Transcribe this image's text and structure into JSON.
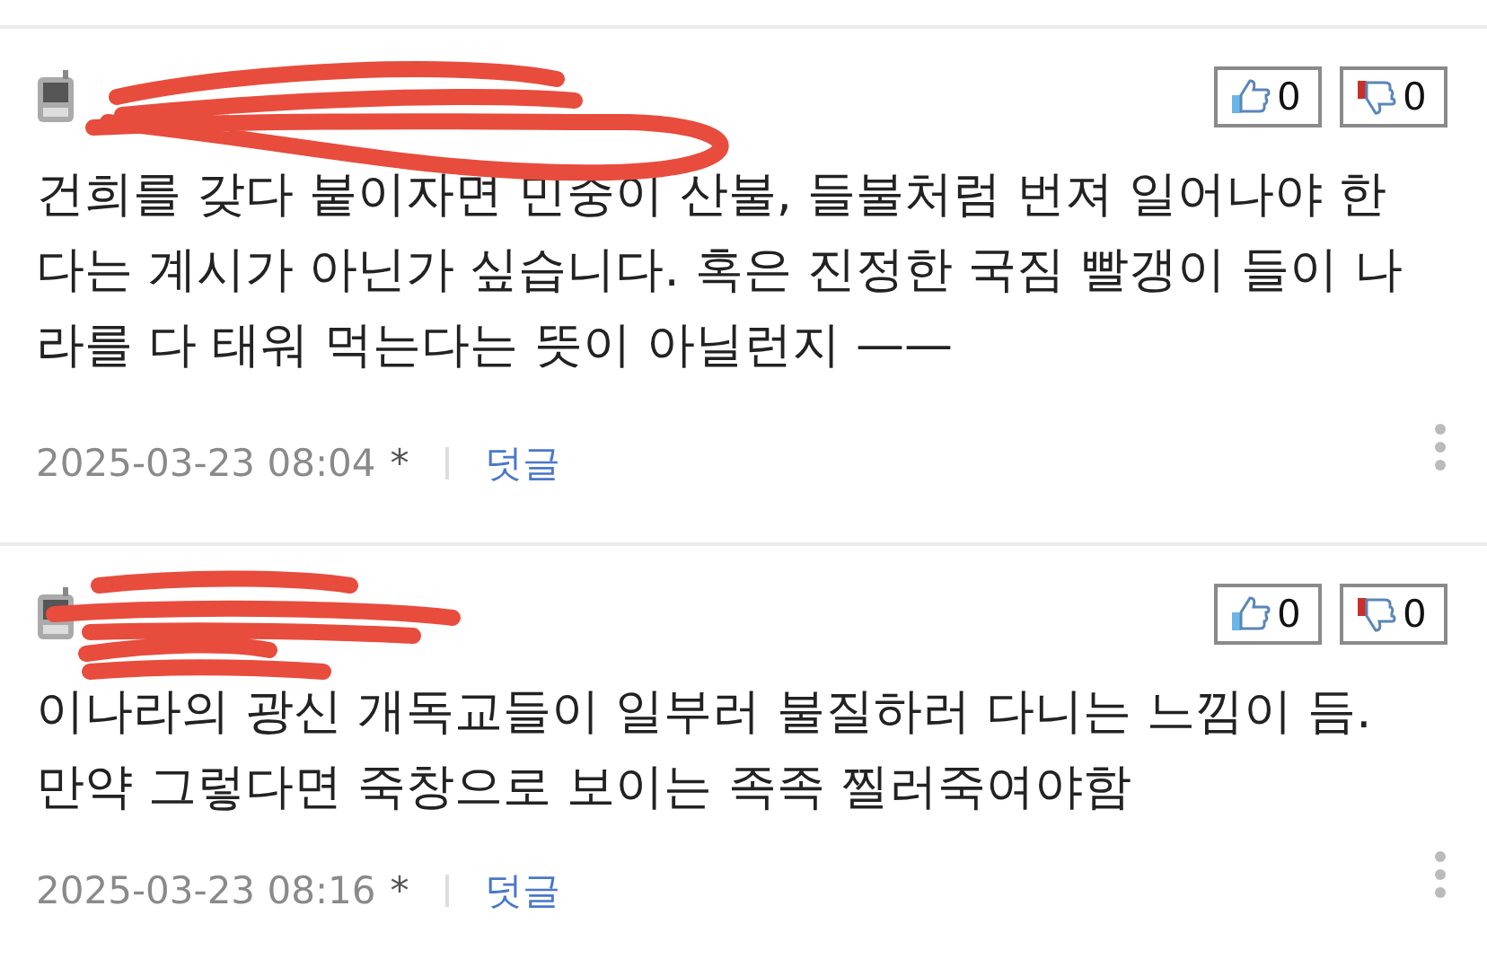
{
  "comments": [
    {
      "likes": "0",
      "dislikes": "0",
      "body": "건희를 갖다 붙이자면 민중이 산불, 들불처럼 번져 일어나야 한다는 계시가 아닌가 싶습니다. 혹은 진정한 국짐 빨갱이 들이 나라를 다 태워 먹는다는 뜻이 아닐런지 ——",
      "date": "2025-03-23 08:04",
      "mark": "*",
      "reply": "덧글"
    },
    {
      "likes": "0",
      "dislikes": "0",
      "body": "이나라의 광신 개독교들이 일부러 불질하러 다니는 느낌이 듬. 만약 그렇다면 죽창으로 보이는 족족 찔러죽여야함",
      "date": "2025-03-23 08:16",
      "mark": "*",
      "reply": "덧글"
    }
  ]
}
